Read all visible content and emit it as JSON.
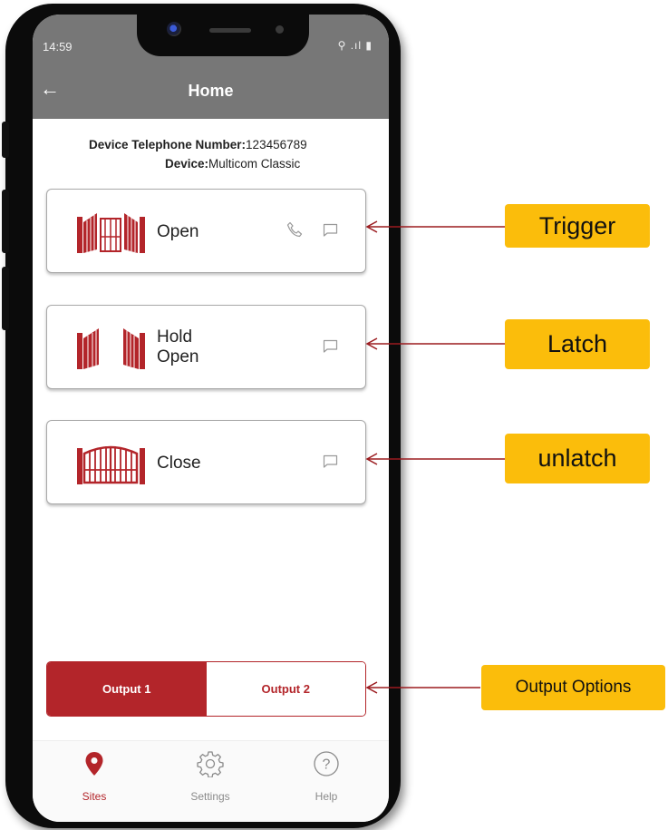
{
  "status_bar": {
    "time": "14:59",
    "icons": "⚲ .ıl ▮"
  },
  "appbar": {
    "back_icon": "arrow-left-icon",
    "title": "Home"
  },
  "device": {
    "telephone_label": "Device Telephone Number:",
    "telephone_value": "123456789",
    "device_label": "Device:",
    "device_value": "Multicom Classic"
  },
  "actions": [
    {
      "label": "Open",
      "icon": "open-gate-icon",
      "has_phone": true,
      "has_message": true
    },
    {
      "label_line1": "Hold",
      "label_line2": "Open",
      "icon": "hold-open-gate-icon",
      "has_phone": false,
      "has_message": true
    },
    {
      "label": "Close",
      "icon": "closed-gate-icon",
      "has_phone": false,
      "has_message": true
    }
  ],
  "outputs": {
    "output1": "Output 1",
    "output2": "Output 2",
    "selected": "Output 1"
  },
  "bottom_nav": [
    {
      "label": "Sites",
      "icon": "location-pin-icon",
      "active": true
    },
    {
      "label": "Settings",
      "icon": "gear-icon",
      "active": false
    },
    {
      "label": "Help",
      "icon": "help-icon",
      "active": false
    }
  ],
  "callouts": {
    "trigger": "Trigger",
    "latch": "Latch",
    "unlatch": "unlatch",
    "output_options": "Output Options"
  },
  "colors": {
    "accent": "#b3252a",
    "appbar": "#777777",
    "callout": "#fbbd0b",
    "nav_inactive": "#8a8a8a"
  }
}
